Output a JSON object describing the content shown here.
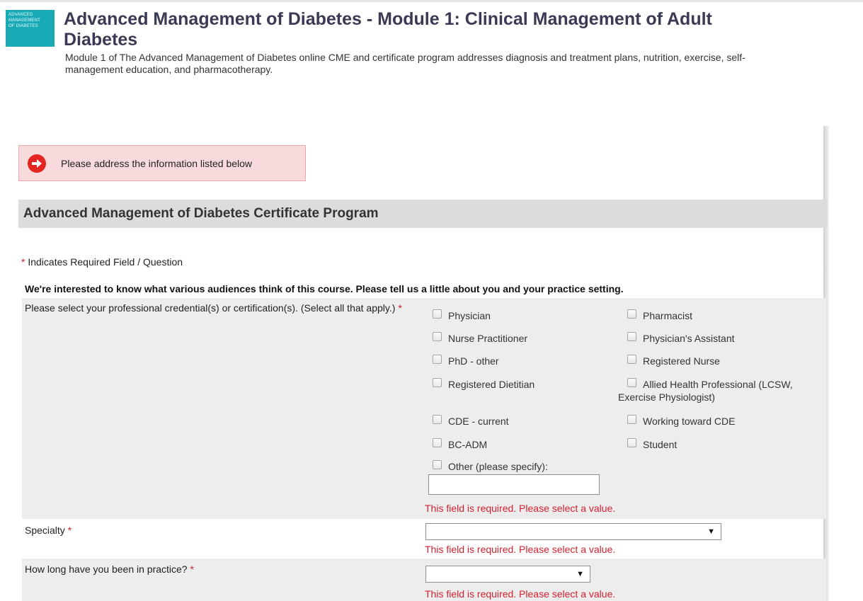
{
  "header": {
    "logo_lines": [
      "ADVANCED",
      "MANAGEMENT",
      "OF DIABETES"
    ],
    "title": "Advanced Management of Diabetes - Module 1: Clinical Management of Adult Diabetes",
    "description": "Module 1 of The Advanced Management of Diabetes online CME and certificate program addresses diagnosis and treatment plans, nutrition, exercise, self-management education, and pharmacotherapy."
  },
  "alert": {
    "text": "Please address the information listed below",
    "icon": "arrow-right-circle-icon"
  },
  "section": {
    "title": "Advanced Management of Diabetes Certificate Program"
  },
  "form": {
    "required_marker": "*",
    "required_note": "Indicates Required Field / Question",
    "intro": "We're interested to know what various audiences think of this course. Please tell us a little about you and your practice setting.",
    "credentials": {
      "label": "Please select your professional credential(s) or certification(s). (Select all that apply.)",
      "options_left": [
        "Physician",
        "Nurse Practitioner",
        "PhD - other",
        "Registered Dietitian",
        "CDE - current",
        "BC-ADM",
        "Other (please specify):"
      ],
      "options_right": [
        "Pharmacist",
        "Physician's Assistant",
        "Registered Nurse",
        "Allied Health Professional (LCSW, Exercise Physiologist)",
        "Working toward CDE",
        "Student"
      ],
      "other_value": "",
      "error": "This field is required. Please select a value."
    },
    "specialty": {
      "label": "Specialty",
      "selected": "",
      "error": "This field is required. Please select a value."
    },
    "practice_length": {
      "label": "How long have you been in practice?",
      "selected": "",
      "error": "This field is required. Please select a value."
    }
  }
}
